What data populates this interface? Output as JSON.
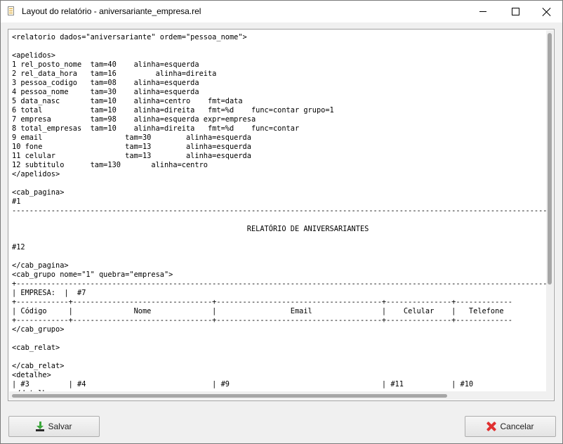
{
  "window": {
    "title": "Layout do relatório - aniversariante_empresa.rel"
  },
  "editor": {
    "content": "<relatorio dados=\"aniversariante\" ordem=\"pessoa_nome\">\n\n<apelidos>\n1 rel_posto_nome  tam=40    alinha=esquerda\n2 rel_data_hora   tam=16         alinha=direita\n3 pessoa_codigo   tam=08    alinha=esquerda\n4 pessoa_nome     tam=30    alinha=esquerda\n5 data_nasc       tam=10    alinha=centro    fmt=data\n6 total           tam=10    alinha=direita   fmt=%d    func=contar grupo=1\n7 empresa         tam=98    alinha=esquerda expr=empresa\n8 total_empresas  tam=10    alinha=direita   fmt=%d    func=contar\n9 email                   tam=30        alinha=esquerda\n10 fone                   tam=13        alinha=esquerda\n11 celular                tam=13        alinha=esquerda\n12 subtitulo      tam=130       alinha=centro\n</apelidos>\n\n<cab_pagina>\n#1\n--------------------------------------------------------------------------------------------------------------------------------------\n\n                                                      RELATÓRIO DE ANIVERSARIANTES\n\n#12\n\n</cab_pagina>\n<cab_grupo nome=\"1\" quebra=\"empresa\">\n+-------------------------------------------------------------------------------------------------------------------------------------\n| EMPRESA:  |  #7\n+------------+--------------------------------+--------------------------------------+---------------+-------------\n| Código     |              Nome              |                 Email                |    Celular    |   Telefone\n+------------+--------------------------------+--------------------------------------+---------------+-------------\n</cab_grupo>\n\n<cab_relat>\n\n</cab_relat>\n<detalhe>\n| #3         | #4                             | #9                                   | #11           | #10\n</detalhe>\n<rod_grupo>"
  },
  "buttons": {
    "save_label": "Salvar",
    "cancel_label": "Cancelar"
  },
  "colors": {
    "save_icon": "#3da83d",
    "cancel_icon": "#e03030"
  }
}
